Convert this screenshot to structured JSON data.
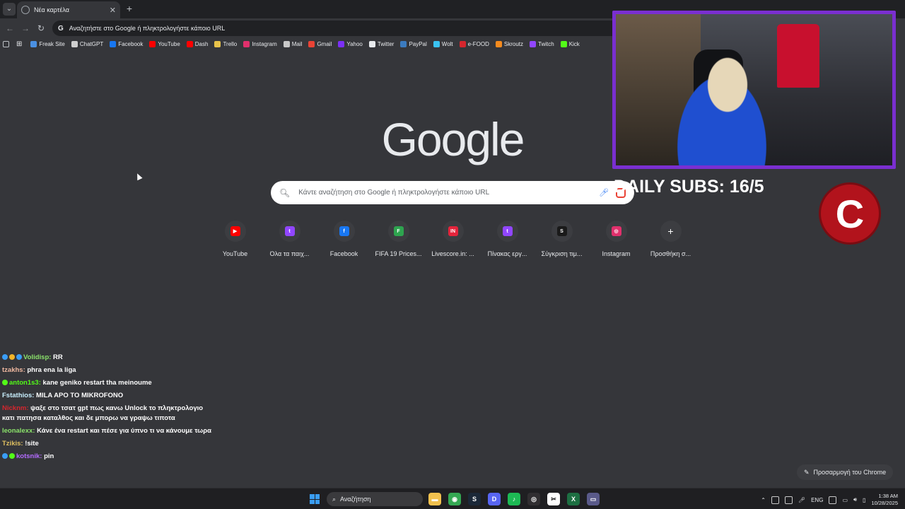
{
  "tabstrip": {
    "tab_title": "Νέα καρτέλα"
  },
  "toolbar": {
    "omnibox_placeholder": "Αναζητήστε στο Google ή πληκτρολογήστε κάποιο URL"
  },
  "bookmarks": [
    {
      "label": "Freak Site",
      "icon": "freak-icon",
      "color": "#4a90e2"
    },
    {
      "label": "ChatGPT",
      "icon": "chatgpt-icon",
      "color": "#cfcfcf"
    },
    {
      "label": "Facebook",
      "icon": "facebook-icon",
      "color": "#1877f2"
    },
    {
      "label": "YouTube",
      "icon": "youtube-icon",
      "color": "#ff0000"
    },
    {
      "label": "Dash",
      "icon": "youtube-icon",
      "color": "#ff0000"
    },
    {
      "label": "Trello",
      "icon": "trello-icon",
      "color": "#e8c34a"
    },
    {
      "label": "Instagram",
      "icon": "instagram-icon",
      "color": "#e1306c"
    },
    {
      "label": "Mail",
      "icon": "mail-icon",
      "color": "#c9c9c9"
    },
    {
      "label": "Gmail",
      "icon": "gmail-icon",
      "color": "#ea4335"
    },
    {
      "label": "Yahoo",
      "icon": "yahoo-icon",
      "color": "#7b2ff7"
    },
    {
      "label": "Twitter",
      "icon": "x-icon",
      "color": "#e8eaed"
    },
    {
      "label": "PayPal",
      "icon": "paypal-icon",
      "color": "#3b7bbf"
    },
    {
      "label": "Wolt",
      "icon": "wolt-icon",
      "color": "#3ac3f2"
    },
    {
      "label": "e-FOOD",
      "icon": "efood-icon",
      "color": "#d6262e"
    },
    {
      "label": "Skroutz",
      "icon": "skroutz-icon",
      "color": "#f68b1e"
    },
    {
      "label": "Twitch",
      "icon": "twitch-icon",
      "color": "#9146ff"
    },
    {
      "label": "Kick",
      "icon": "kick-icon",
      "color": "#53fc18"
    }
  ],
  "ntp": {
    "logo": "Google",
    "search_placeholder": "Κάντε αναζήτηση στο Google ή πληκτρολογήστε κάποιο URL",
    "shortcuts": [
      {
        "label": "YouTube",
        "icon": "youtube-icon",
        "color": "#ff0000",
        "glyph": "▶"
      },
      {
        "label": "Όλα τα παιχ...",
        "icon": "twitch-icon",
        "color": "#9146ff",
        "glyph": "t"
      },
      {
        "label": "Facebook",
        "icon": "facebook-icon",
        "color": "#1877f2",
        "glyph": "f"
      },
      {
        "label": "FIFA 19 Prices...",
        "icon": "futbin-icon",
        "color": "#2ea44f",
        "glyph": "F"
      },
      {
        "label": "Livescore.in: ...",
        "icon": "livescore-icon",
        "color": "#e4243b",
        "glyph": "IN"
      },
      {
        "label": "Πίνακας εργ...",
        "icon": "twitch-icon",
        "color": "#9146ff",
        "glyph": "t"
      },
      {
        "label": "Σύγκριση τιμ...",
        "icon": "skroutz-icon",
        "color": "#1a1a1a",
        "glyph": "S"
      },
      {
        "label": "Instagram",
        "icon": "instagram-icon",
        "color": "#e1306c",
        "glyph": "◎"
      },
      {
        "label": "Προσθήκη σ...",
        "icon": "plus-icon",
        "color": "#3c3d41",
        "glyph": "+"
      }
    ],
    "customize_label": "Προσαρμογή του Chrome"
  },
  "overlay": {
    "subs_text": "DAILY SUBS: 16/5",
    "channel_logo_letter": "C"
  },
  "chat": [
    {
      "user": "Volidisp:",
      "color": "#8be36b",
      "badges": [
        "#3a9df5",
        "#f0b429",
        "#3a9df5"
      ],
      "text": "RR"
    },
    {
      "user": "tzakhs:",
      "color": "#f0b8a0",
      "badges": [],
      "text": "phra ena la liga"
    },
    {
      "user": "anton1s3:",
      "color": "#53fc18",
      "badges": [
        "#53fc18"
      ],
      "text": "kane geniko restart tha meinoume"
    },
    {
      "user": "Fstathios:",
      "color": "#c9f0ff",
      "badges": [],
      "text": "MILA APO TO MIKROFONO"
    },
    {
      "user": "Nicknm:",
      "color": "#d6262e",
      "badges": [],
      "text": "ψαξε στο τσατ gpt πως κανω Unlock το πληκτρολογιο κατι πατησα καταλθος και δε μπορω να γραψω τιποτα"
    },
    {
      "user": "leonalexx:",
      "color": "#8be36b",
      "badges": [],
      "text": "Κάνε ένα restart και πέσε για ύπνο τι να κάνουμε τωρα"
    },
    {
      "user": "Tzikis:",
      "color": "#e0c060",
      "badges": [],
      "text": "!site"
    },
    {
      "user": "kotsnik:",
      "color": "#b46cff",
      "badges": [
        "#3a9df5",
        "#53fc18"
      ],
      "text": "pin"
    }
  ],
  "taskbar": {
    "search_placeholder": "Αναζήτηση",
    "language": "ENG",
    "time": "1:38 AM",
    "date": "10/28/2025",
    "apps": [
      {
        "name": "file-explorer-icon",
        "color": "#f2c14e",
        "glyph": "▬"
      },
      {
        "name": "chrome-icon",
        "color": "#34a853",
        "glyph": "◉"
      },
      {
        "name": "steam-icon",
        "color": "#1b2838",
        "glyph": "S"
      },
      {
        "name": "discord-icon",
        "color": "#5865f2",
        "glyph": "D"
      },
      {
        "name": "spotify-icon",
        "color": "#1db954",
        "glyph": "♪"
      },
      {
        "name": "obs-icon",
        "color": "#302e31",
        "glyph": "◎"
      },
      {
        "name": "capcut-icon",
        "color": "#ffffff",
        "glyph": "✂"
      },
      {
        "name": "excel-icon",
        "color": "#1d6f42",
        "glyph": "X"
      },
      {
        "name": "app-icon",
        "color": "#5a5a8a",
        "glyph": "▭"
      }
    ]
  }
}
